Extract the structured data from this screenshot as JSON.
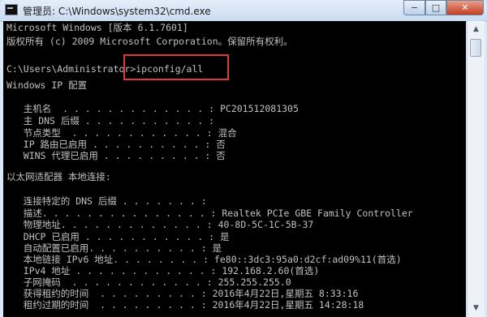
{
  "window": {
    "title": "管理员: C:\\Windows\\system32\\cmd.exe"
  },
  "controls": {
    "minimize": "−",
    "maximize": "□",
    "close": "✕"
  },
  "icons": {
    "app": "cmd-icon",
    "scroll_up": "▲",
    "scroll_down": "▼"
  },
  "console": {
    "lines": [
      "Microsoft Windows [版本 6.1.7601]",
      "版权所有 (c) 2009 Microsoft Corporation。保留所有权利。",
      "",
      "C:\\Users\\Administrator>ipconfig/all",
      "",
      "Windows IP 配置",
      "",
      "   主机名  . . . . . . . . . . . . . : PC201512081305",
      "   主 DNS 后缀 . . . . . . . . . . . :",
      "   节点类型  . . . . . . . . . . . . : 混合",
      "   IP 路由已启用 . . . . . . . . . . : 否",
      "   WINS 代理已启用 . . . . . . . . . : 否",
      "",
      "以太网适配器 本地连接:",
      "",
      "   连接特定的 DNS 后缀 . . . . . . . :",
      "   描述. . . . . . . . . . . . . . . : Realtek PCIe GBE Family Controller",
      "   物理地址. . . . . . . . . . . . . : 40-8D-5C-1C-5B-37",
      "   DHCP 已启用 . . . . . . . . . . . : 是",
      "   自动配置已启用. . . . . . . . . . : 是",
      "   本地链接 IPv6 地址. . . . . . . . : fe80::3dc3:95a0:d2cf:ad09%11(首选)",
      "   IPv4 地址 . . . . . . . . . . . . : 192.168.2.60(首选)",
      "   子网掩码  . . . . . . . . . . . . : 255.255.255.0",
      "   获得租约的时间  . . . . . . . . . : 2016年4月22日,星期五 8:33:16",
      "   租约过期的时间  . . . . . . . . . : 2016年4月22日,星期五 14:28:18"
    ]
  },
  "colors": {
    "console_bg": "#000000",
    "console_text": "#c0c0c0",
    "highlight_box": "#d93a3a"
  }
}
